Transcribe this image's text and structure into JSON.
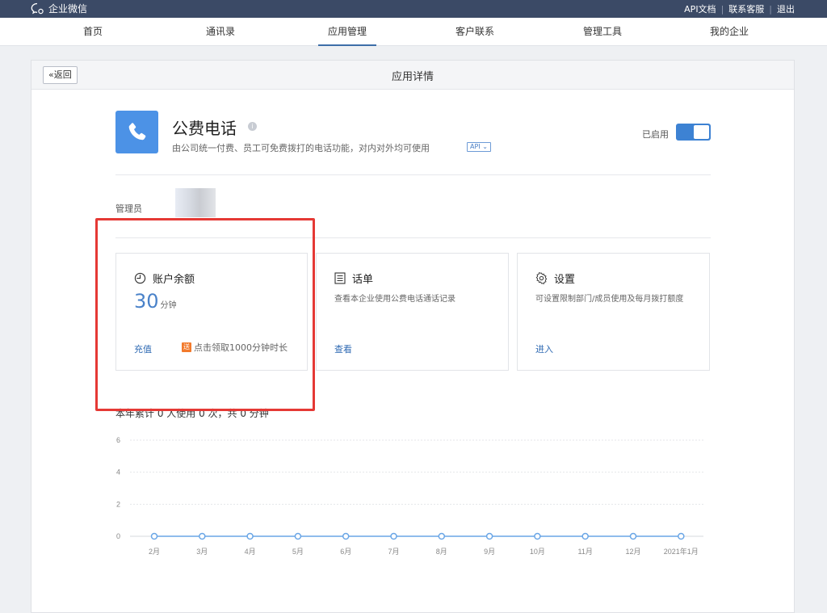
{
  "topbar": {
    "app_title": "企业微信",
    "links": [
      "API文档",
      "联系客服",
      "退出"
    ]
  },
  "nav": {
    "items": [
      "首页",
      "通讯录",
      "应用管理",
      "客户联系",
      "管理工具",
      "我的企业"
    ],
    "active": "应用管理"
  },
  "panel": {
    "back_label": "返回",
    "title": "应用详情"
  },
  "app": {
    "icon": "phone-icon",
    "name": "公费电话",
    "description": "由公司统一付费、员工可免费拨打的电话功能，对内对外均可使用",
    "api_badge": "API",
    "status_label": "已启用",
    "enabled": true,
    "admin_label": "管理员"
  },
  "cards": {
    "balance": {
      "title": "账户余额",
      "icon": "clock-icon",
      "value": "30",
      "unit": "分钟",
      "action": "充值",
      "promo_tag": "送",
      "promo_text": "点击领取1000分钟时长"
    },
    "records": {
      "title": "话单",
      "icon": "list-icon",
      "description": "查看本企业使用公费电话通话记录",
      "action": "查看"
    },
    "settings": {
      "title": "设置",
      "icon": "gear-icon",
      "description": "可设置限制部门/成员使用及每月拨打额度",
      "action": "进入"
    }
  },
  "stats": {
    "summary": "本年累计 0 人使用 0 次，共 0 分钟"
  },
  "colors": {
    "accent": "#3d82d3",
    "topbar": "#3b4a66",
    "highlight": "#e53935",
    "line": "#6aa6e6"
  },
  "chart_data": {
    "type": "line",
    "categories": [
      "2月",
      "3月",
      "4月",
      "5月",
      "6月",
      "7月",
      "8月",
      "9月",
      "10月",
      "11月",
      "12月",
      "2021年1月"
    ],
    "series": [
      {
        "values": [
          0,
          0,
          0,
          0,
          0,
          0,
          0,
          0,
          0,
          0,
          0,
          0
        ]
      }
    ],
    "yticks": [
      0,
      2,
      4,
      6
    ],
    "ylim": [
      0,
      6
    ],
    "grid": true
  }
}
